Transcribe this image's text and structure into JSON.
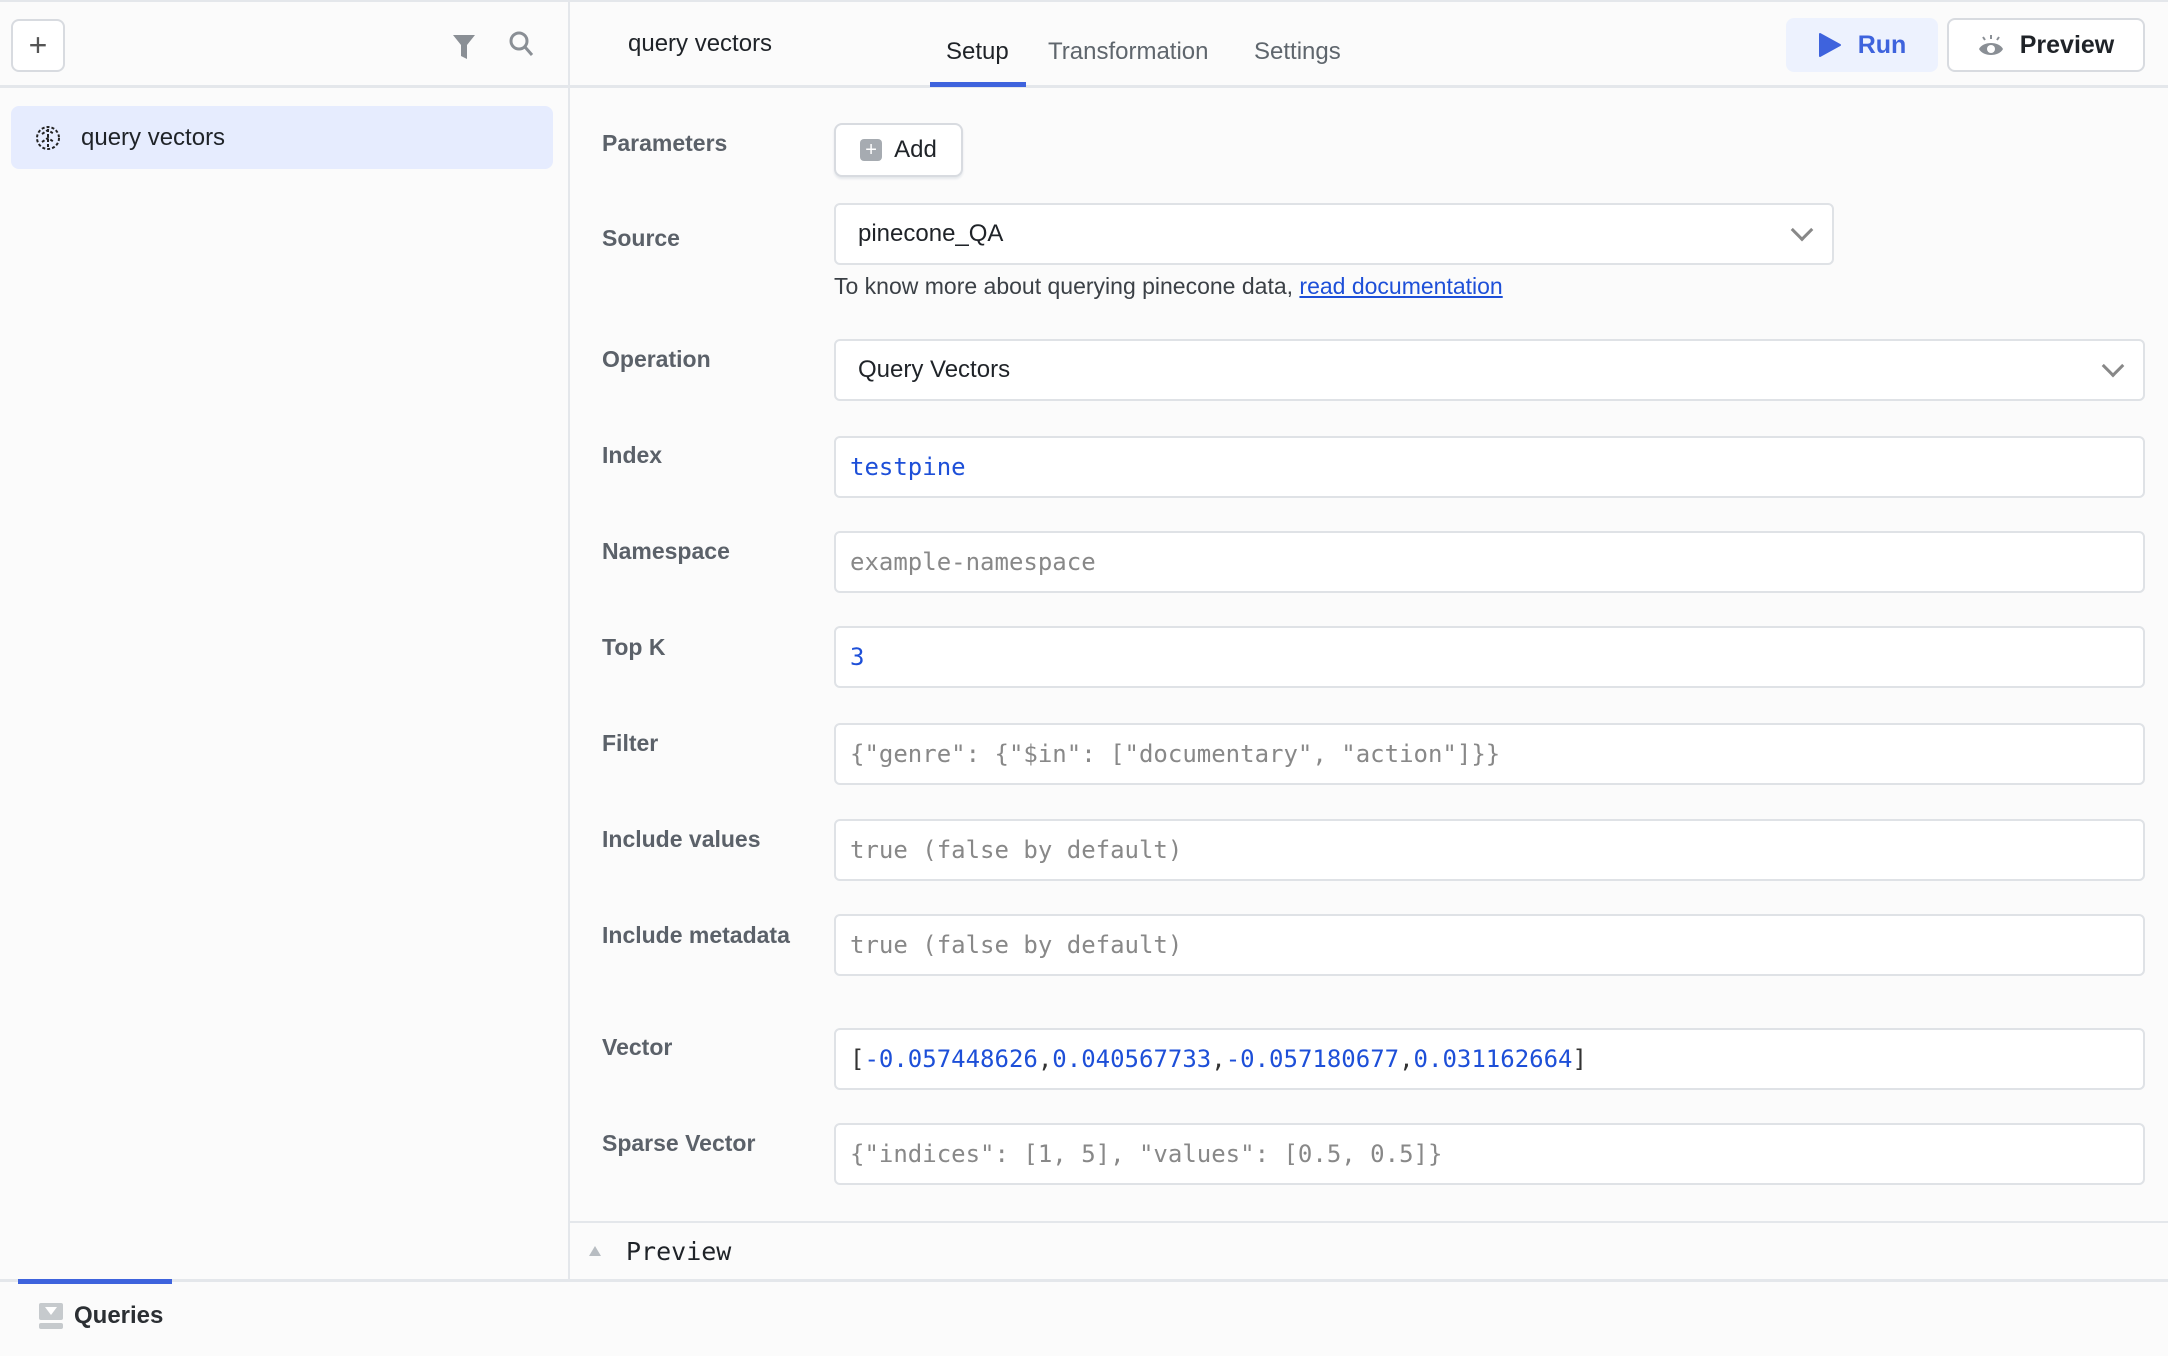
{
  "sidebar": {
    "add_label": "+",
    "items": [
      {
        "label": "query vectors",
        "icon": "pinecone-icon"
      }
    ]
  },
  "header": {
    "title": "query vectors",
    "tabs": [
      {
        "label": "Setup",
        "active": true
      },
      {
        "label": "Transformation"
      },
      {
        "label": "Settings"
      }
    ],
    "run_label": "Run",
    "preview_label": "Preview"
  },
  "form": {
    "parameters": {
      "label": "Parameters",
      "add_label": "Add"
    },
    "source": {
      "label": "Source",
      "value": "pinecone_QA",
      "help_text": "To know more about querying pinecone data, ",
      "help_link": "read documentation"
    },
    "operation": {
      "label": "Operation",
      "value": "Query Vectors"
    },
    "index": {
      "label": "Index",
      "value": "testpine"
    },
    "namespace": {
      "label": "Namespace",
      "placeholder": "example-namespace"
    },
    "top_k": {
      "label": "Top K",
      "value": "3"
    },
    "filter": {
      "label": "Filter",
      "placeholder": "{\"genre\": {\"$in\": [\"documentary\", \"action\"]}}"
    },
    "include_values": {
      "label": "Include values",
      "placeholder": "true (false by default)"
    },
    "include_metadata": {
      "label": "Include metadata",
      "placeholder": "true (false by default)"
    },
    "vector": {
      "label": "Vector",
      "values": [
        "-0.057448626",
        "0.040567733",
        "-0.057180677",
        "0.031162664"
      ]
    },
    "sparse_vector": {
      "label": "Sparse Vector",
      "placeholder": "{\"indices\": [1, 5], \"values\": [0.5, 0.5]}"
    }
  },
  "preview_panel": {
    "label": "Preview"
  },
  "bottom": {
    "queries_label": "Queries"
  },
  "colors": {
    "accent": "#3e63dd",
    "value": "#1d4fd8"
  }
}
